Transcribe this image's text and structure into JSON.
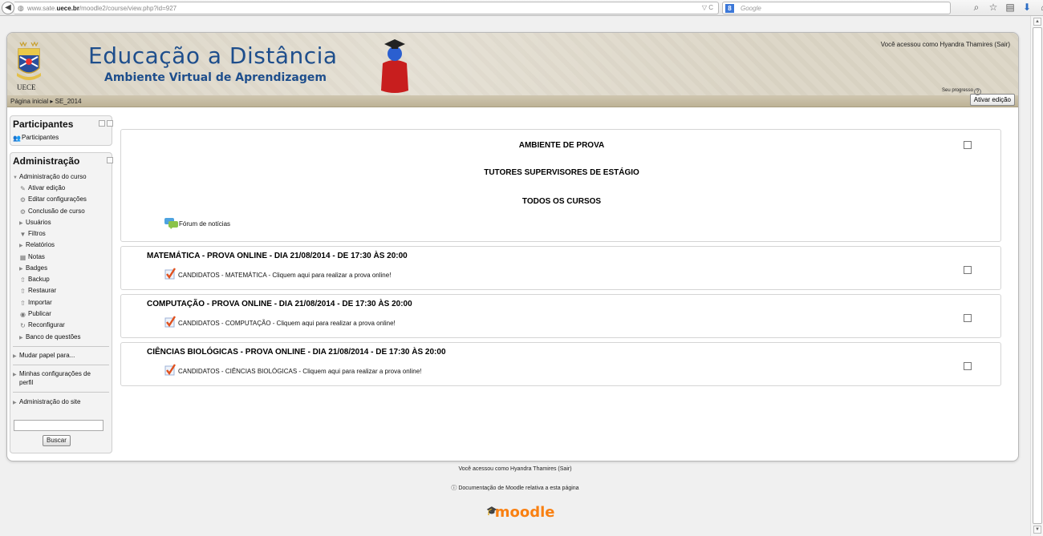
{
  "browser": {
    "url_prefix": "www.sate.",
    "url_host": "uece.br",
    "url_path": "/moodle2/course/view.php?id=927",
    "url_tools": "▽ C",
    "search_engine": "8",
    "search_placeholder": "Google"
  },
  "header": {
    "site_title": "Educação a Distância",
    "site_subtitle": "Ambiente Virtual de Aprendizagem",
    "logo_text": "UECE",
    "login_info": "Você acessou como Hyandra Thamires (Sair)"
  },
  "navbar": {
    "breadcrumb": "Página inicial ▸ SE_2014",
    "edit_button": "Ativar edição"
  },
  "participants_block": {
    "title": "Participantes",
    "item": "Participantes"
  },
  "admin_block": {
    "title": "Administração",
    "course_admin": "Administração do curso",
    "items": [
      "Ativar edição",
      "Editar configurações",
      "Conclusão de curso",
      "Usuários",
      "Filtros",
      "Relatórios",
      "Notas",
      "Badges",
      "Backup",
      "Restaurar",
      "Importar",
      "Publicar",
      "Reconfigurar",
      "Banco de questões"
    ],
    "switch_role": "Mudar papel para...",
    "profile_settings_1": "Minhas configurações de",
    "profile_settings_2": "perfil",
    "site_admin": "Administração do site",
    "search_button": "Buscar"
  },
  "main": {
    "progress_label": "Seu progresso",
    "section0": {
      "line1": "AMBIENTE DE PROVA",
      "line2": "TUTORES SUPERVISORES DE ESTÁGIO",
      "line3": "TODOS OS CURSOS",
      "forum": "Fórum de notícias"
    },
    "sections": [
      {
        "title": "MATEMÁTICA - PROVA ONLINE - DIA 21/08/2014 - DE 17:30 ÀS 20:00",
        "activity": "CANDIDATOS - MATEMÁTICA - Cliquem aqui para realizar a prova online!"
      },
      {
        "title": "COMPUTAÇÃO - PROVA ONLINE - DIA 21/08/2014 - DE 17:30 ÀS 20:00",
        "activity": "CANDIDATOS - COMPUTAÇÃO - Cliquem aqui para realizar a prova online!"
      },
      {
        "title": "CIÊNCIAS BIOLÓGICAS - PROVA ONLINE - DIA 21/08/2014 - DE 17:30 ÀS 20:00",
        "activity": "CANDIDATOS - CIÊNCIAS BIOLÓGICAS - Cliquem aqui para realizar a prova online!"
      }
    ]
  },
  "footer": {
    "login_info": "Você acessou como Hyandra Thamires (Sair)",
    "docs": "Documentação de Moodle relativa a esta página",
    "logo": "moodle"
  },
  "colors": {
    "brand_blue": "#1e4e8c",
    "header_bg": "#ddd7c8",
    "moodle_orange": "#f98012"
  }
}
